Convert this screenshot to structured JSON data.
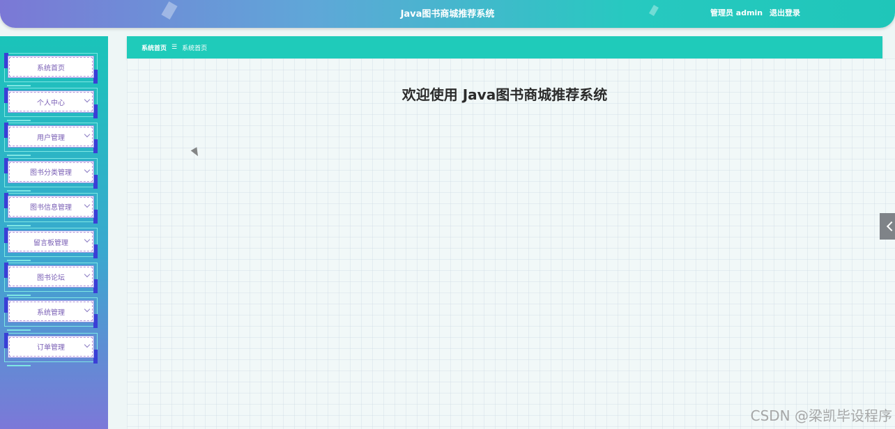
{
  "header": {
    "title": "Java图书商城推荐系统",
    "user_label": "管理员 admin",
    "logout_label": "退出登录"
  },
  "sidebar": {
    "items": [
      {
        "label": "系统首页",
        "has_chevron": false
      },
      {
        "label": "个人中心",
        "has_chevron": true
      },
      {
        "label": "用户管理",
        "has_chevron": true
      },
      {
        "label": "图书分类管理",
        "has_chevron": true
      },
      {
        "label": "图书信息管理",
        "has_chevron": true
      },
      {
        "label": "留言板管理",
        "has_chevron": true
      },
      {
        "label": "图书论坛",
        "has_chevron": true
      },
      {
        "label": "系统管理",
        "has_chevron": true
      },
      {
        "label": "订单管理",
        "has_chevron": true
      }
    ]
  },
  "breadcrumb": {
    "home": "系统首页",
    "separator": "☰",
    "current": "系统首页"
  },
  "main": {
    "welcome": "欢迎使用 Java图书商城推荐系统"
  },
  "watermark": "CSDN @梁凯毕设程序",
  "colors": {
    "accent": "#1fcbba",
    "sidebar_top": "#1ac4b9",
    "sidebar_bottom": "#7c78d8",
    "menu_text": "#7a5fb5"
  }
}
